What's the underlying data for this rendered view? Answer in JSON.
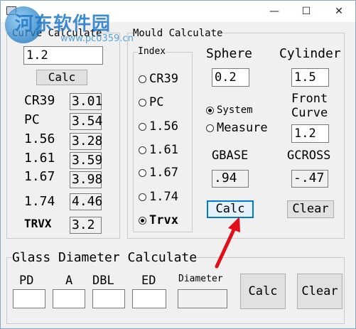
{
  "window": {
    "minimize": "—",
    "maximize": "☐",
    "close": "✕"
  },
  "watermark": {
    "title": "河东软件园",
    "url": "www.pc0359.cn"
  },
  "curve": {
    "title": "Curve Calculate",
    "input": "1.2",
    "calc_label": "Calc",
    "rows": [
      {
        "label": "CR39",
        "value": "3.01"
      },
      {
        "label": "PC",
        "value": "3.54"
      },
      {
        "label": "1.56",
        "value": "3.28"
      },
      {
        "label": "1.61",
        "value": "3.59"
      },
      {
        "label": "1.67",
        "value": "3.98"
      },
      {
        "label": "1.74",
        "value": "4.46"
      },
      {
        "label": "TRVX",
        "value": "3.2"
      }
    ]
  },
  "mould": {
    "title": "Mould Calculate",
    "index_title": "Index",
    "options": [
      {
        "label": "CR39",
        "selected": false
      },
      {
        "label": "PC",
        "selected": false
      },
      {
        "label": "1.56",
        "selected": false
      },
      {
        "label": "1.61",
        "selected": false
      },
      {
        "label": "1.67",
        "selected": false
      },
      {
        "label": "1.74",
        "selected": false
      },
      {
        "label": "Trvx",
        "selected": true
      }
    ],
    "sphere_label": "Sphere",
    "sphere_value": "0.2",
    "cylinder_label": "Cylinder",
    "cylinder_value": "1.5",
    "mode_system": "System",
    "mode_measure": "Measure",
    "front_curve_line1": "Front",
    "front_curve_line2": "Curve",
    "front_curve_value": "1.2",
    "gbase_label": "GBASE",
    "gbase_value": ".94",
    "gcross_label": "GCROSS",
    "gcross_value": "-.47",
    "calc_label": "Calc",
    "clear_label": "Clear"
  },
  "glass": {
    "title": "Glass Diameter Calculate",
    "pd_label": "PD",
    "a_label": "A",
    "dbl_label": "DBL",
    "ed_label": "ED",
    "diameter_label": "Diameter",
    "pd_value": "",
    "a_value": "",
    "dbl_value": "",
    "ed_value": "",
    "diameter_value": "",
    "calc_label": "Calc",
    "clear_label": "Clear"
  },
  "annotation": {
    "arrow_color": "#e0101a"
  }
}
